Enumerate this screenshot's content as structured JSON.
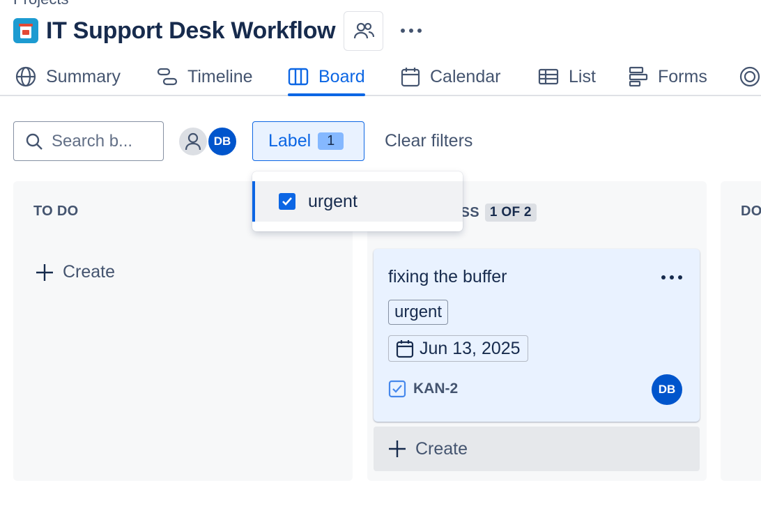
{
  "breadcrumb": "Projects",
  "header": {
    "title": "IT Support Desk Workflow",
    "project_icon": "project-icon",
    "people_icon": "people-icon",
    "more_icon": "more-icon"
  },
  "tabs": [
    {
      "label": "Summary",
      "icon": "globe-icon",
      "active": false
    },
    {
      "label": "Timeline",
      "icon": "timeline-icon",
      "active": false
    },
    {
      "label": "Board",
      "icon": "board-icon",
      "active": true
    },
    {
      "label": "Calendar",
      "icon": "calendar-icon",
      "active": false
    },
    {
      "label": "List",
      "icon": "list-icon",
      "active": false
    },
    {
      "label": "Forms",
      "icon": "forms-icon",
      "active": false
    }
  ],
  "toolbar": {
    "search_placeholder": "Search b...",
    "avatar_initials": "DB",
    "label_filter": "Label",
    "label_filter_count": "1",
    "clear_filters": "Clear filters"
  },
  "dropdown": {
    "items": [
      {
        "label": "urgent",
        "checked": true
      }
    ]
  },
  "columns": [
    {
      "title": "TO DO",
      "create_label": "Create"
    },
    {
      "title": "IN PROGRESS",
      "visible_title": "ESS",
      "count": "1 OF 2",
      "create_label": "Create"
    },
    {
      "title": "DO"
    }
  ],
  "card": {
    "title": "fixing the buffer",
    "label": "urgent",
    "due_date": "Jun 13, 2025",
    "key": "KAN-2",
    "assignee_initials": "DB"
  },
  "colors": {
    "accent": "#0c66e4",
    "avatar": "#0055cc",
    "card_bg": "#e9f2ff",
    "column_bg": "#f7f8f9"
  }
}
